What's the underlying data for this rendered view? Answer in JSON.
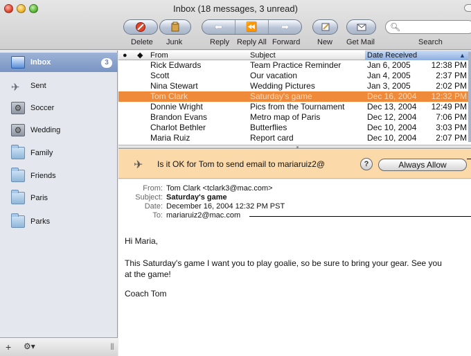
{
  "window": {
    "title": "Inbox (18 messages, 3 unread)"
  },
  "toolbar": {
    "delete_label": "Delete",
    "junk_label": "Junk",
    "reply_label": "Reply",
    "reply_all_label": "Reply All",
    "forward_label": "Forward",
    "new_label": "New",
    "get_mail_label": "Get Mail",
    "search_label": "Search",
    "search_placeholder": ""
  },
  "sidebar": {
    "items": [
      {
        "label": "Inbox",
        "badge": "3",
        "icon": "inbox-tray-icon"
      },
      {
        "label": "Sent",
        "icon": "paper-plane-icon"
      },
      {
        "label": "Soccer",
        "icon": "smart-folder-gear-icon"
      },
      {
        "label": "Wedding",
        "icon": "smart-folder-gear-icon"
      },
      {
        "label": "Family",
        "icon": "folder-icon"
      },
      {
        "label": "Friends",
        "icon": "folder-icon"
      },
      {
        "label": "Paris",
        "icon": "folder-icon"
      },
      {
        "label": "Parks",
        "icon": "folder-icon"
      }
    ]
  },
  "list": {
    "columns": {
      "from": "From",
      "subject": "Subject",
      "date": "Date Received"
    },
    "rows": [
      {
        "from": "Rick Edwards",
        "subject": "Team Practice Reminder",
        "date": "Jan 6, 2005",
        "time": "12:38 PM"
      },
      {
        "from": "Scott",
        "subject": "Our vacation",
        "date": "Jan 4, 2005",
        "time": "2:37 PM"
      },
      {
        "from": "Nina Stewart",
        "subject": "Wedding Pictures",
        "date": "Jan 3, 2005",
        "time": "2:02 PM"
      },
      {
        "from": "Tom Clark",
        "subject": "Saturday's game",
        "date": "Dec 16, 2004",
        "time": "12:32 PM",
        "selected": true
      },
      {
        "from": "Donnie Wright",
        "subject": "Pics from the Tournament",
        "date": "Dec 13, 2004",
        "time": "12:49 PM"
      },
      {
        "from": "Brandon Evans",
        "subject": "Metro map of Paris",
        "date": "Dec 12, 2004",
        "time": "7:06 PM"
      },
      {
        "from": "Charlot Bethler",
        "subject": "Butterflies",
        "date": "Dec 10, 2004",
        "time": "3:03 PM"
      },
      {
        "from": "Maria Ruiz",
        "subject": "Report card",
        "date": "Dec 10, 2004",
        "time": "2:07 PM"
      }
    ]
  },
  "alert": {
    "text": "Is it OK for Tom to send email to mariaruiz2@",
    "help_label": "?",
    "allow_label": "Always Allow"
  },
  "message": {
    "from_key": "From:",
    "from": "Tom Clark <tclark3@mac.com>",
    "subject_key": "Subject:",
    "subject": "Saturday's game",
    "date_key": "Date:",
    "date": "December 16, 2004 12:32 PM PST",
    "to_key": "To:",
    "to": "mariaruiz2@mac.com",
    "greeting": "Hi Maria,",
    "body": "This Saturday's game I want you to play goalie, so be sure to bring your gear. See you at the game!",
    "signoff": "Coach Tom"
  },
  "colors": {
    "selected_row": "#f08a3b",
    "alert_bg": "#fbd9a8",
    "sidebar_selected": "#7894c2"
  }
}
